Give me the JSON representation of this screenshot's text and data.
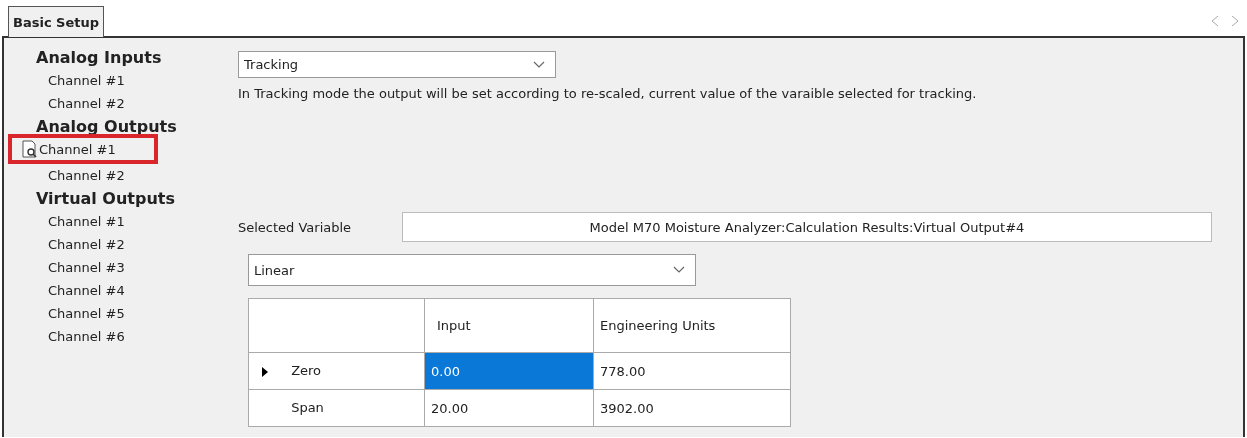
{
  "tabs": [
    {
      "label": "Basic Setup",
      "selected": true
    }
  ],
  "sidebar": {
    "groups": [
      {
        "heading": "Analog Inputs",
        "items": [
          {
            "label": "Channel #1",
            "selected": false
          },
          {
            "label": "Channel #2",
            "selected": false
          }
        ]
      },
      {
        "heading": "Analog Outputs",
        "items": [
          {
            "label": "Channel #1",
            "selected": true
          },
          {
            "label": "Channel #2",
            "selected": false
          }
        ]
      },
      {
        "heading": "Virtual Outputs",
        "items": [
          {
            "label": "Channel #1",
            "selected": false
          },
          {
            "label": "Channel #2",
            "selected": false
          },
          {
            "label": "Channel #3",
            "selected": false
          },
          {
            "label": "Channel #4",
            "selected": false
          },
          {
            "label": "Channel #5",
            "selected": false
          },
          {
            "label": "Channel #6",
            "selected": false
          }
        ]
      }
    ]
  },
  "mode_dropdown": {
    "value": "Tracking"
  },
  "description": "In Tracking mode the output will be set according to re-scaled, current value of the varaible selected for tracking.",
  "selected_variable": {
    "label": "Selected Variable",
    "value": "Model M70 Moisture Analyzer:Calculation Results:Virtual Output#4"
  },
  "scaling_dropdown": {
    "value": "Linear"
  },
  "table": {
    "columns": [
      "Input",
      "Engineering Units"
    ],
    "rows": [
      {
        "label": "Zero",
        "current": true,
        "cells": [
          {
            "value": "0.00",
            "selected": true
          },
          {
            "value": "778.00",
            "selected": false
          }
        ]
      },
      {
        "label": "Span",
        "current": false,
        "cells": [
          {
            "value": "20.00",
            "selected": false
          },
          {
            "value": "3902.00",
            "selected": false
          }
        ]
      }
    ]
  }
}
